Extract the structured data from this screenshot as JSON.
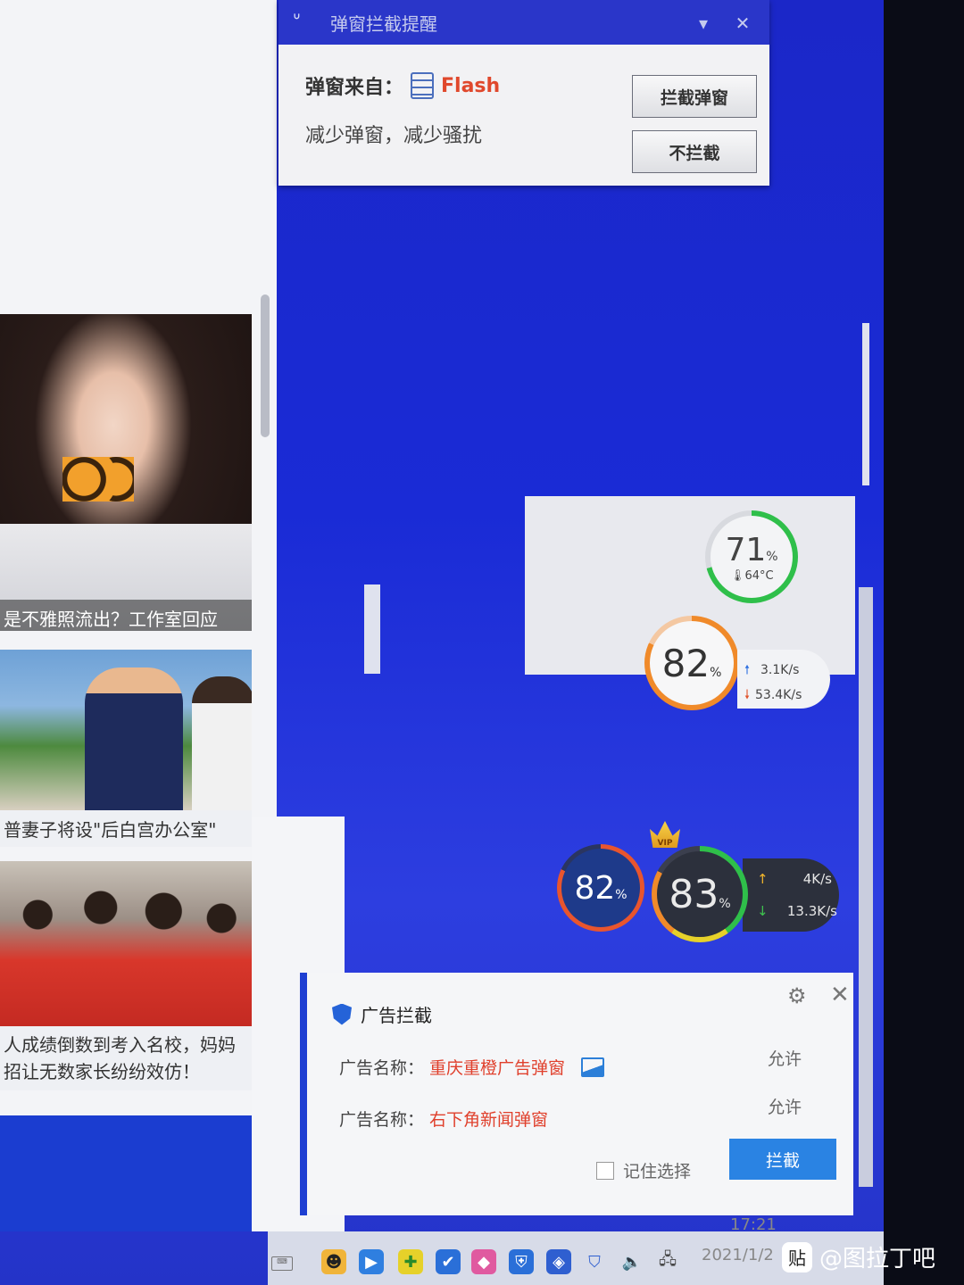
{
  "popup_notify": {
    "title": "弹窗拦截提醒",
    "source_label": "弹窗来自：",
    "source_name": "Flash",
    "subtitle": "减少弹窗，减少骚扰",
    "block_button": "拦截弹窗",
    "allow_button": "不拦截",
    "menu_icon": "▾",
    "close_icon": "✕"
  },
  "news": {
    "captions": [
      "是不雅照流出？工作室回应",
      "普妻子将设\"后白宫办公室\"",
      "人成绩倒数到考入名校，妈妈",
      "招让无数家长纷纷效仿！"
    ]
  },
  "monitor_widget": {
    "cpu_percent": "71",
    "cpu_unit": "%",
    "temperature": "64°C",
    "mem_percent": "82",
    "mem_unit": "%",
    "upload": "3.1K/s",
    "download": "53.4K/s"
  },
  "vip_widget": {
    "left_percent": "82",
    "left_unit": "%",
    "main_percent": "83",
    "main_unit": "%",
    "upload": "4K/s",
    "download": "13.3K/s",
    "crown_label": "VIP"
  },
  "ad_dialog": {
    "title": "广告拦截",
    "rows": [
      {
        "label": "广告名称：",
        "name": "重庆重橙广告弹窗",
        "action": "允许"
      },
      {
        "label": "广告名称：",
        "name": "右下角新闻弹窗",
        "action": "允许"
      }
    ],
    "remember": "记住选择",
    "block_button": "拦截"
  },
  "taskbar": {
    "time": "17:21",
    "date": "2021/1/2"
  },
  "watermark": {
    "text": "@图拉丁吧",
    "badge": "贴"
  },
  "colors": {
    "desktop_blue": "#1b27c8",
    "accent_red": "#e0402c",
    "button_blue": "#2a83e3"
  }
}
